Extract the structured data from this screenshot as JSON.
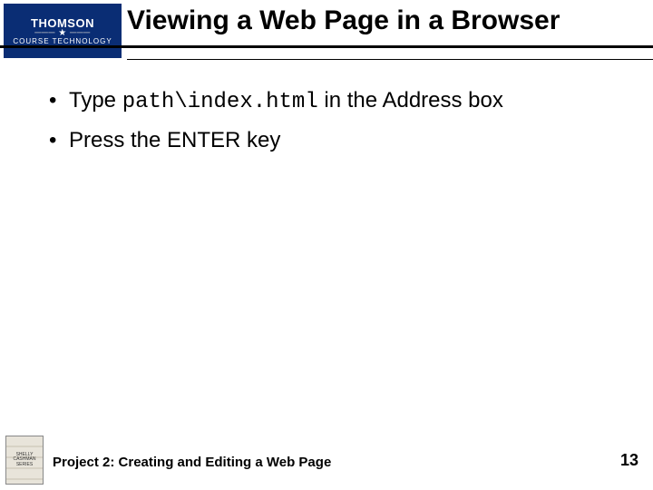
{
  "logo": {
    "top": "THOMSON",
    "bottom": "COURSE TECHNOLOGY"
  },
  "title": "Viewing a Web Page in a Browser",
  "bullets": [
    {
      "pre": "Type ",
      "code": "path\\index.html",
      "post": " in the Address box"
    },
    {
      "pre": "Press the ENTER key",
      "code": "",
      "post": ""
    }
  ],
  "footer": {
    "series_line1": "SHELLY",
    "series_line2": "CASHMAN",
    "series_line3": "SERIES",
    "text": "Project 2: Creating and Editing a Web Page",
    "page": "13"
  }
}
